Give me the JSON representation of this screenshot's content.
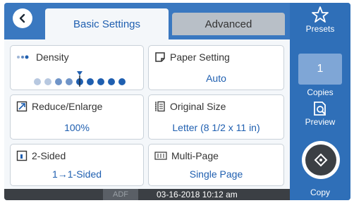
{
  "tabs": {
    "basic_label": "Basic Settings",
    "advanced_label": "Advanced"
  },
  "settings": {
    "density": {
      "label": "Density",
      "level": 5,
      "max": 9
    },
    "paper_setting": {
      "label": "Paper Setting",
      "value": "Auto"
    },
    "reduce_enlarge": {
      "label": "Reduce/Enlarge",
      "value": "100%"
    },
    "original_size": {
      "label": "Original Size",
      "value": "Letter (8 1/2 x 11 in)"
    },
    "two_sided": {
      "label": "2-Sided",
      "value": "1→1-Sided"
    },
    "multi_page": {
      "label": "Multi-Page",
      "value": "Single Page"
    }
  },
  "status": {
    "adf": "ADF",
    "datetime": "03-16-2018 10:12 am"
  },
  "side": {
    "presets_label": "Presets",
    "copies_value": "1",
    "copies_label": "Copies",
    "preview_label": "Preview",
    "copy_label": "Copy"
  },
  "colors": {
    "accent": "#2f6fb8",
    "value_text": "#1f5fb0"
  }
}
